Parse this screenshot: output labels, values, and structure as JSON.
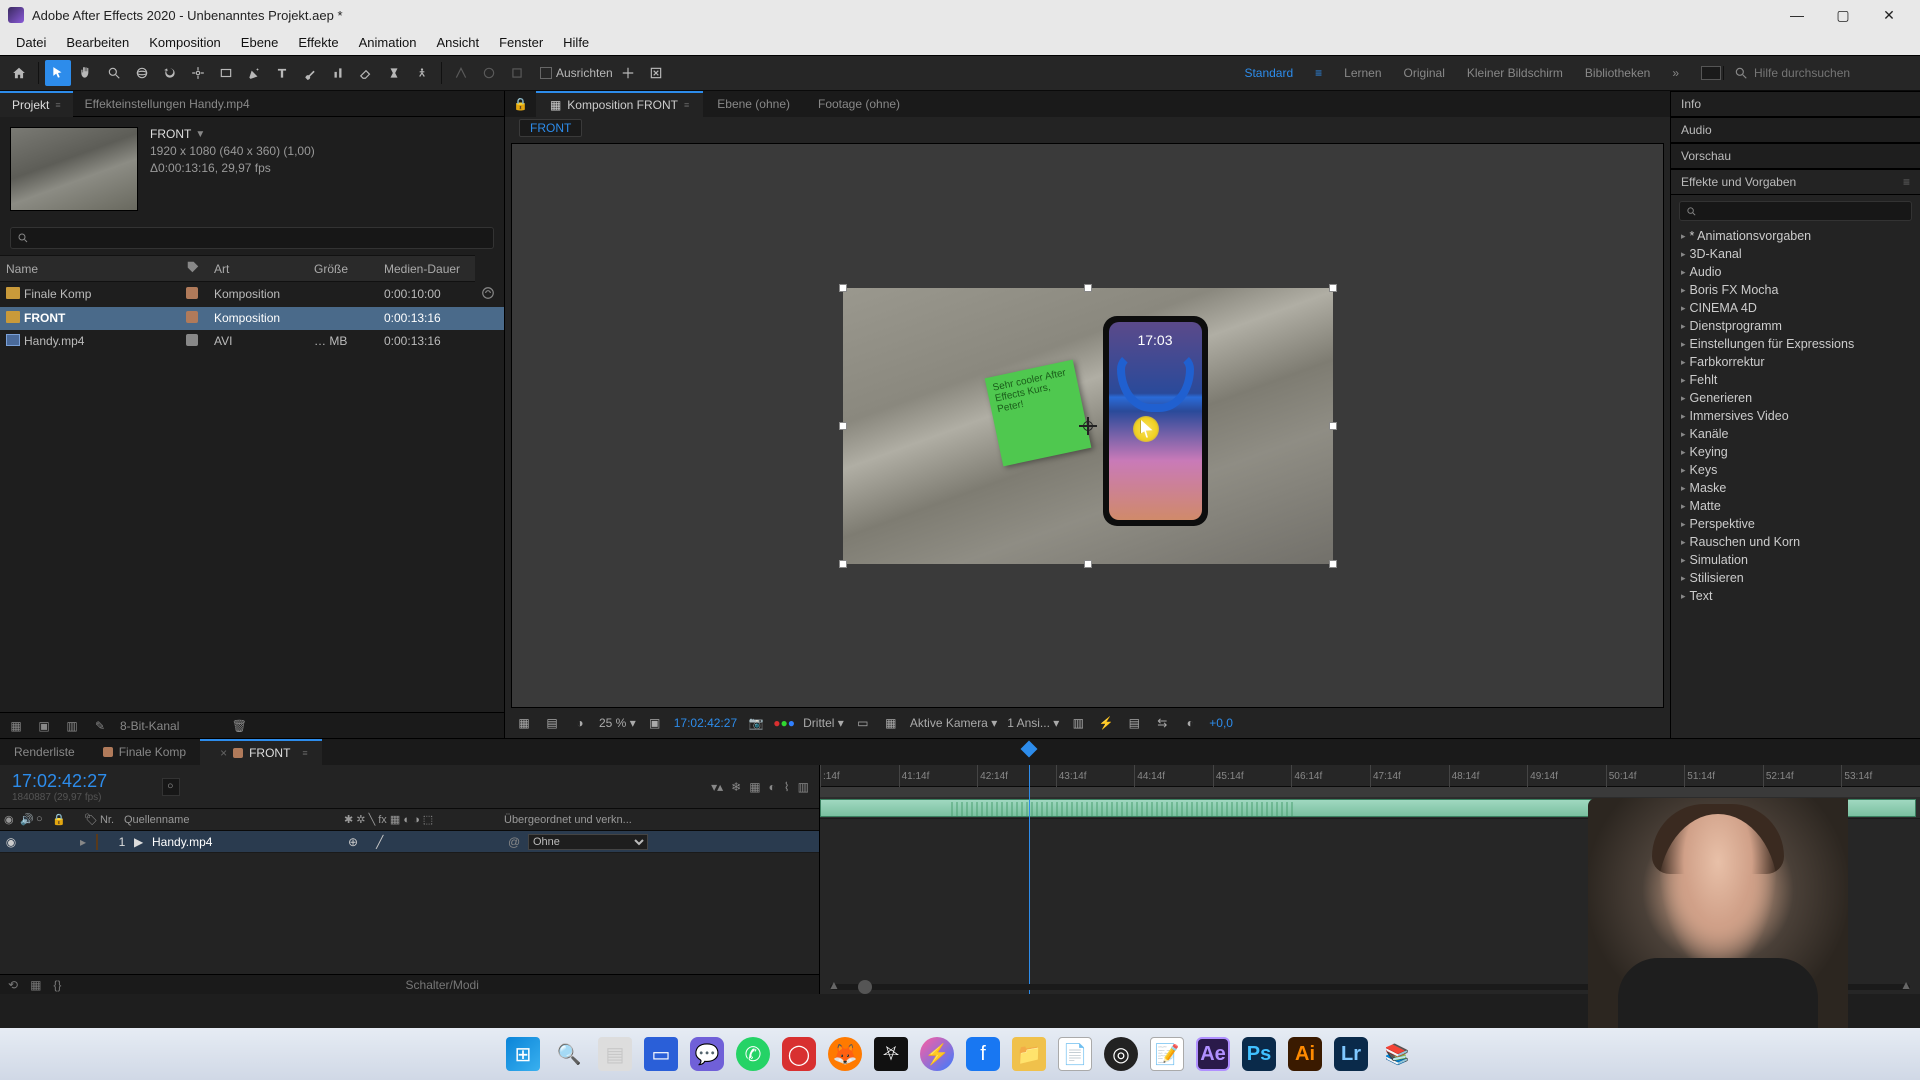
{
  "window": {
    "title": "Adobe After Effects 2020 - Unbenanntes Projekt.aep *"
  },
  "menus": [
    "Datei",
    "Bearbeiten",
    "Komposition",
    "Ebene",
    "Effekte",
    "Animation",
    "Ansicht",
    "Fenster",
    "Hilfe"
  ],
  "toolbar": {
    "ausrichten": "Ausrichten",
    "workspaces": {
      "active": "Standard",
      "items": [
        "Standard",
        "Lernen",
        "Original",
        "Kleiner Bildschirm",
        "Bibliotheken"
      ]
    },
    "search_placeholder": "Hilfe durchsuchen"
  },
  "project": {
    "tab_project": "Projekt",
    "tab_effectctl": "Effekteinstellungen  Handy.mp4",
    "selected": {
      "name": "FRONT",
      "dims": "1920 x 1080 (640 x 360) (1,00)",
      "dur": "Δ0:00:13:16, 29,97 fps"
    },
    "columns": {
      "name": "Name",
      "art": "Art",
      "size": "Größe",
      "dur": "Medien-Dauer"
    },
    "items": [
      {
        "name": "Finale Komp",
        "type": "Komposition",
        "size": "",
        "dur": "0:00:10:00",
        "kind": "comp"
      },
      {
        "name": "FRONT",
        "type": "Komposition",
        "size": "",
        "dur": "0:00:13:16",
        "kind": "comp",
        "selected": true
      },
      {
        "name": "Handy.mp4",
        "type": "AVI",
        "size": "… MB",
        "dur": "0:00:13:16",
        "kind": "clip"
      }
    ],
    "footer_bits": "8-Bit-Kanal"
  },
  "comp": {
    "tab_label": "Komposition FRONT",
    "tab_layer": "Ebene (ohne)",
    "tab_footage": "Footage (ohne)",
    "breadcrumb": "FRONT",
    "phone_time": "17:03",
    "sticky_text": "Sehr cooler\\nAfter Effects\\nKurs, Peter!",
    "footer": {
      "zoom": "25 %",
      "tc": "17:02:42:27",
      "res": "Drittel",
      "camera": "Aktive Kamera",
      "views": "1 Ansi...",
      "exposure": "+0,0"
    }
  },
  "rightPanels": {
    "info": "Info",
    "audio": "Audio",
    "preview": "Vorschau",
    "effects": "Effekte und Vorgaben",
    "effcats": [
      "* Animationsvorgaben",
      "3D-Kanal",
      "Audio",
      "Boris FX Mocha",
      "CINEMA 4D",
      "Dienstprogramm",
      "Einstellungen für Expressions",
      "Farbkorrektur",
      "Fehlt",
      "Generieren",
      "Immersives Video",
      "Kanäle",
      "Keying",
      "Keys",
      "Maske",
      "Matte",
      "Perspektive",
      "Rauschen und Korn",
      "Simulation",
      "Stilisieren",
      "Text"
    ]
  },
  "timeline": {
    "tabs": {
      "render": "Renderliste",
      "t1": "Finale Komp",
      "t2": "FRONT"
    },
    "tc_big": "17:02:42:27",
    "tc_small": "1840887 (29,97 fps)",
    "cols": {
      "nr": "Nr.",
      "name": "Quellenname",
      "parent": "Übergeordnet und verkn..."
    },
    "layer": {
      "nr": "1",
      "name": "Handy.mp4",
      "parent_none": "Ohne"
    },
    "switches_label": "Schalter/Modi",
    "ticks": [
      ":14f",
      "41:14f",
      "42:14f",
      "43:14f",
      "44:14f",
      "45:14f",
      "46:14f",
      "47:14f",
      "48:14f",
      "49:14f",
      "50:14f",
      "51:14f",
      "52:14f",
      "53:14f",
      "-"
    ],
    "cti_pct": 19
  }
}
